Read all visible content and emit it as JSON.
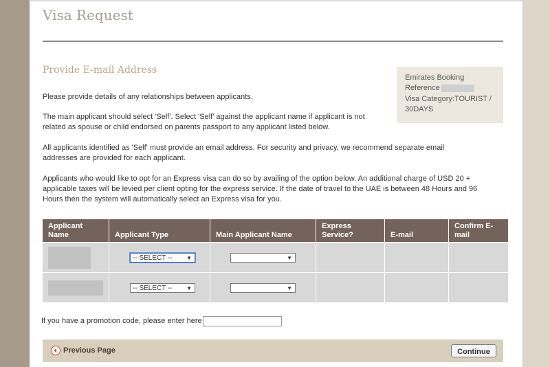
{
  "page": {
    "title": "Visa Request",
    "section_title": "Provide E-mail Address"
  },
  "info_box": {
    "booking_label": "Emirates Booking",
    "reference_label": "Reference",
    "visa_category": "Visa Category:TOURIST / 30DAYS"
  },
  "paragraphs": [
    "Please provide details of any relationships between applicants.",
    "The main applicant should select 'Self'. Select 'Self' against the applicant name if applicant is not related as spouse or child endorsed on parents passport to any applicant listed below.",
    "All applicants identified as 'Self' must provide an email address. For security and privacy, we recommend separate email addresses are provided for each applicant.",
    "Applicants who would like to opt for an Express visa can do so by availing of the option below. An additional charge of USD 20 + applicable taxes will be levied per client opting for the express service. If the date of travel to the UAE is between 48 Hours and 96 Hours then the system will automatically select an Express visa for you."
  ],
  "table": {
    "headers": [
      "Applicant Name",
      "Applicant Type",
      "Main Applicant Name",
      "Express Service?",
      "E-mail",
      "Confirm E-mail"
    ],
    "rows": [
      {
        "applicant_type": "-- SELECT --",
        "main_applicant": ""
      },
      {
        "applicant_type": "-- SELECT --",
        "main_applicant": ""
      }
    ]
  },
  "promo": {
    "label": "If you have a promotion code, please enter here",
    "value": ""
  },
  "nav": {
    "previous_label": "Previous Page",
    "continue_label": "Continue"
  },
  "icons": {
    "dropdown_arrow": "▼"
  }
}
